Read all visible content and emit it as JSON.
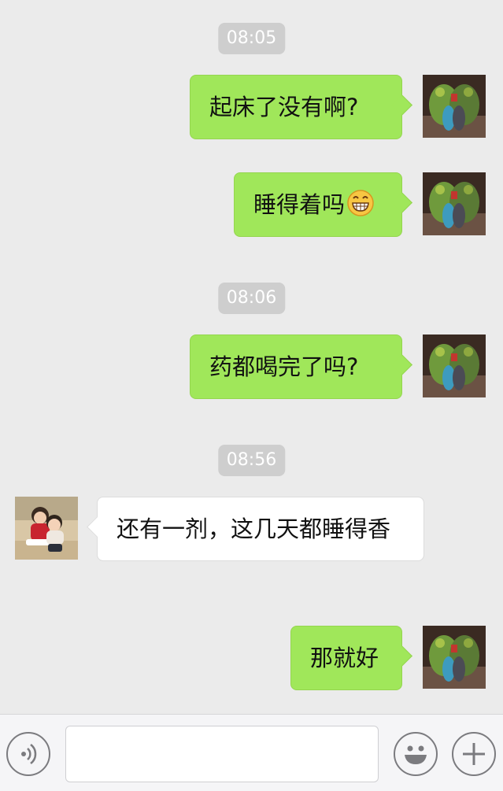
{
  "messages": [
    {
      "kind": "time",
      "text": "08:05"
    },
    {
      "kind": "me",
      "text": "起床了没有啊?"
    },
    {
      "kind": "me",
      "text": "睡得着吗",
      "emoji": "grinning-face-icon"
    },
    {
      "kind": "time",
      "text": "08:06"
    },
    {
      "kind": "me",
      "text": "药都喝完了吗?"
    },
    {
      "kind": "time",
      "text": "08:56"
    },
    {
      "kind": "other",
      "text": "还有一剂，这几天都睡得香"
    },
    {
      "kind": "me",
      "text": "那就好"
    }
  ],
  "input_bar": {
    "voice_icon": "voice-icon",
    "emoji_icon": "smiley-icon",
    "more_icon": "plus-icon",
    "input_value": ""
  },
  "colors": {
    "background": "#ebebeb",
    "my_bubble": "#a0e75a",
    "other_bubble": "#ffffff",
    "timestamp_bg": "#cecece"
  }
}
